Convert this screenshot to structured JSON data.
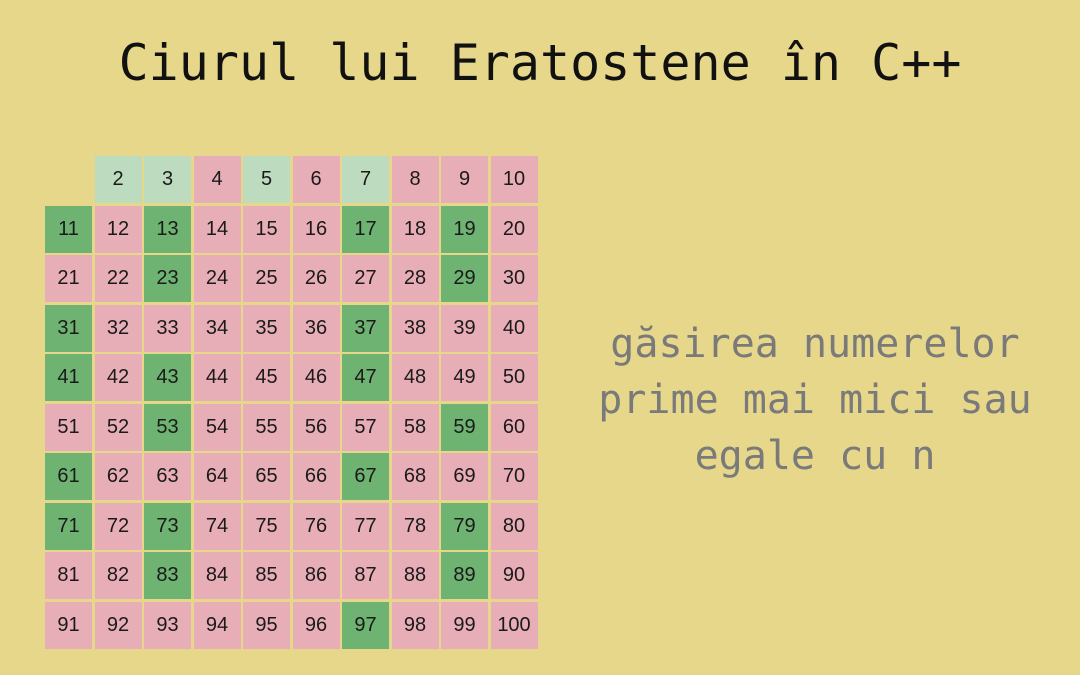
{
  "title": "Ciurul lui Eratostene în C++",
  "subtitle_lines": [
    "găsirea numerelor",
    "prime mai mici sau",
    "egale cu n"
  ],
  "colors": {
    "background": "#e6d78a",
    "composite": "#e8aeb7",
    "prime": "#6fb373",
    "prime_small": "#bddcbf",
    "subtitle": "#7a7a7a"
  },
  "grid": {
    "first": 2,
    "last": 100,
    "columns": 10,
    "primes": [
      2,
      3,
      5,
      7,
      11,
      13,
      17,
      19,
      23,
      29,
      31,
      37,
      41,
      43,
      47,
      53,
      59,
      61,
      67,
      71,
      73,
      79,
      83,
      89,
      97
    ],
    "light_primes": [
      2,
      3,
      5,
      7
    ]
  }
}
